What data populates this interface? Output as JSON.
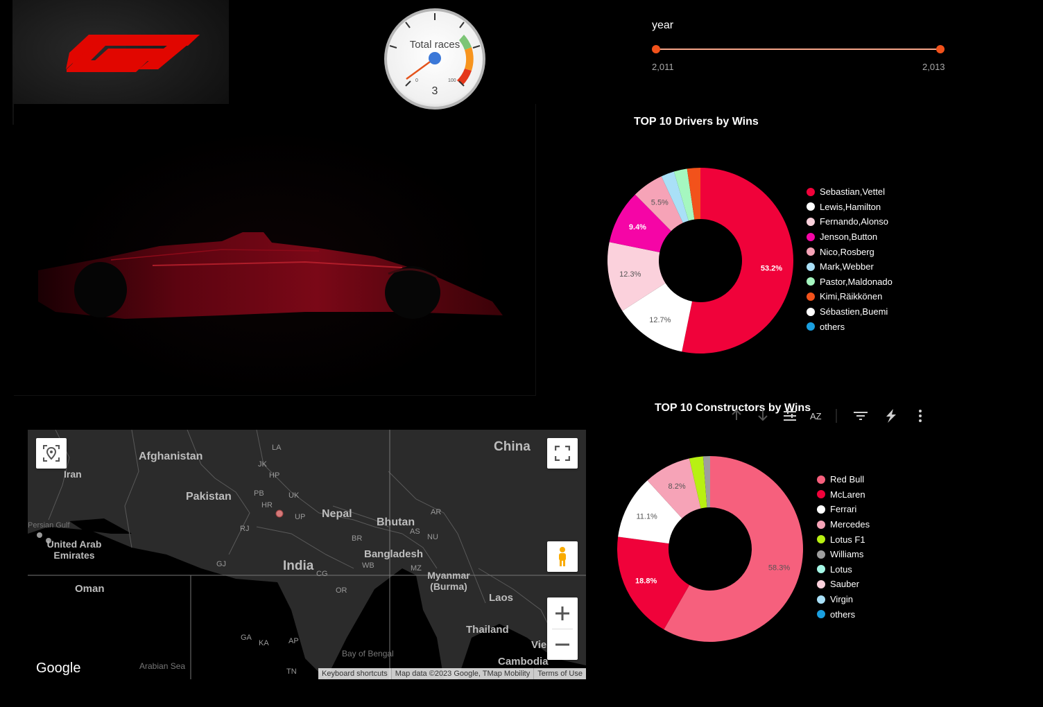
{
  "gauge": {
    "title": "Total races",
    "value": "3",
    "min_label": "0",
    "max_label": "100"
  },
  "year_filter": {
    "label": "year",
    "start": "2,011",
    "end": "2,013"
  },
  "toolbar": {
    "sort_az": "AZ",
    "icons": [
      "arrow-up-icon",
      "arrow-down-icon",
      "drill-icon",
      "sort-az-icon",
      "filter-icon",
      "lightning-icon",
      "more-vert-icon"
    ]
  },
  "map": {
    "brand": "Google",
    "footer": {
      "shortcuts": "Keyboard shortcuts",
      "data": "Map data ©2023 Google, TMap Mobility",
      "terms": "Terms of Use"
    },
    "labels": {
      "china": "China",
      "afghanistan": "Afghanistan",
      "iran": "Iran",
      "pakistan": "Pakistan",
      "nepal": "Nepal",
      "bhutan": "Bhutan",
      "uae": "United Arab Emirates",
      "bangladesh": "Bangladesh",
      "india": "India",
      "oman": "Oman",
      "myanmar": "Myanmar (Burma)",
      "laos": "Laos",
      "thailand": "Thailand",
      "cambodia": "Cambodia",
      "vie": "Vie",
      "bay_of_bengal": "Bay of Bengal",
      "arabian_sea": "Arabian Sea",
      "persian_gulf": "Persian Gulf",
      "jk": "JK",
      "la": "LA",
      "hp": "HP",
      "pb": "PB",
      "hr": "HR",
      "uk": "UK",
      "up": "UP",
      "rj": "RJ",
      "gj": "GJ",
      "br": "BR",
      "wb": "WB",
      "as": "AS",
      "ar": "AR",
      "nu": "NU",
      "mz": "MZ",
      "cg": "CG",
      "or": "OR",
      "ga": "GA",
      "ka": "KA",
      "ap": "AP",
      "tn": "TN"
    }
  },
  "chart_data": [
    {
      "type": "pie",
      "title": "TOP 10 Drivers by Wins",
      "categories": [
        "Sebastian,Vettel",
        "Lewis,Hamilton",
        "Fernando,Alonso",
        "Jenson,Button",
        "Nico,Rosberg",
        "Mark,Webber",
        "Pastor,Maldonado",
        "Kimi,Räikkönen",
        "Sébastien,Buemi",
        "others"
      ],
      "values": [
        53.2,
        12.7,
        12.3,
        9.4,
        5.5,
        2.3,
        2.3,
        2.3,
        0,
        0
      ],
      "data_labels": [
        "53.2%",
        "12.7%",
        "12.3%",
        "9.4%",
        "5.5%",
        "",
        "",
        "",
        "",
        ""
      ],
      "colors": [
        "#f0023a",
        "#ffffff",
        "#fbd1dc",
        "#f505a6",
        "#f6a3b7",
        "#a9e0f7",
        "#a5f7c0",
        "#f2521b",
        "#ffffff",
        "#1a9fe0"
      ],
      "legend": "right"
    },
    {
      "type": "pie",
      "title": "TOP 10 Constructors by Wins",
      "categories": [
        "Red Bull",
        "McLaren",
        "Ferrari",
        "Mercedes",
        "Lotus F1",
        "Williams",
        "Lotus",
        "Sauber",
        "Virgin",
        "others"
      ],
      "values": [
        58.3,
        18.8,
        11.1,
        8.2,
        2.4,
        1.2,
        0,
        0,
        0,
        0
      ],
      "data_labels": [
        "58.3%",
        "18.8%",
        "11.1%",
        "8.2%",
        "",
        "",
        "",
        "",
        "",
        ""
      ],
      "colors": [
        "#f6607d",
        "#f0023a",
        "#ffffff",
        "#f6a3b7",
        "#b8f012",
        "#9e9e9e",
        "#a5f7e6",
        "#fbd1dc",
        "#a9e0f7",
        "#1a9fe0"
      ],
      "legend": "right"
    }
  ],
  "colors": {
    "slider": "#f2521b",
    "slider_track": "#f7a58a",
    "background": "#000000"
  }
}
